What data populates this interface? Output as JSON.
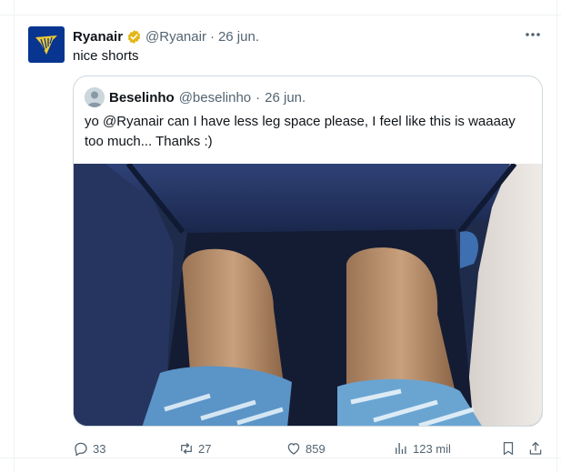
{
  "tweet": {
    "author_name": "Ryanair",
    "author_handle": "@Ryanair",
    "separator": "·",
    "date": "26 jun.",
    "text": "nice shorts",
    "quoted": {
      "author_name": "Beselinho",
      "author_handle": "@beselinho",
      "date": "26 jun.",
      "text": "yo @Ryanair can I have less leg space please, I feel like this is waaaay too much... Thanks :)"
    },
    "actions": {
      "replies": "33",
      "reposts": "27",
      "likes": "859",
      "views": "123 mil"
    }
  },
  "colors": {
    "brand_navy": "#073590",
    "brand_gold": "#f1c933",
    "verified_gold": "#e2b719",
    "secondary_text": "#536471",
    "border": "#cfd9de"
  },
  "icons": {
    "more": "more-icon",
    "reply": "reply-icon",
    "repost": "repost-icon",
    "like": "like-icon",
    "views": "views-icon",
    "bookmark": "bookmark-icon",
    "share": "share-icon"
  }
}
